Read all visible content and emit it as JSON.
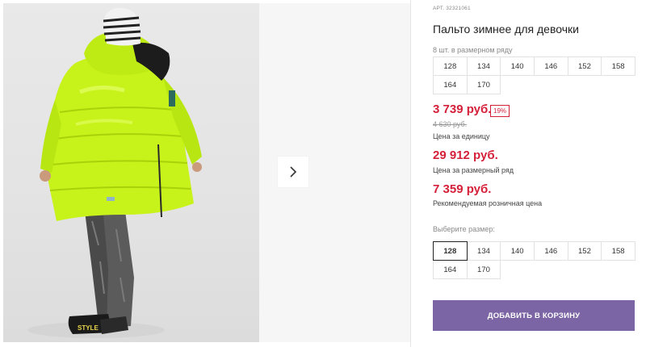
{
  "product": {
    "sku": "АРТ. 32321061",
    "title": "Пальто зимнее для девочки",
    "pack_label": "8 шт. в размерном ряду",
    "pack_sizes": [
      "128",
      "134",
      "140",
      "146",
      "152",
      "158",
      "164",
      "170"
    ]
  },
  "pricing": {
    "current": "3 739 руб.",
    "discount": "19%",
    "old": "4 630 руб.",
    "unit_caption": "Цена за единицу",
    "pack_price": "29 912 руб.",
    "pack_caption": "Цена за размерный ряд",
    "rrp": "7 359 руб.",
    "rrp_caption": "Рекомендуемая розничная цена",
    "accent_color": "#d5203a"
  },
  "size_picker": {
    "label": "Выберите размер:",
    "selected": "128",
    "options": [
      "128",
      "134",
      "140",
      "146",
      "152",
      "158",
      "164",
      "170"
    ]
  },
  "cart": {
    "add_label": "ДОБАВИТЬ В КОРЗИНУ",
    "button_color": "#7b65a5"
  },
  "gallery": {
    "next_icon": "chevron-right-icon",
    "image_subject": "girl in neon yellow-green winter coat with fur hood"
  }
}
